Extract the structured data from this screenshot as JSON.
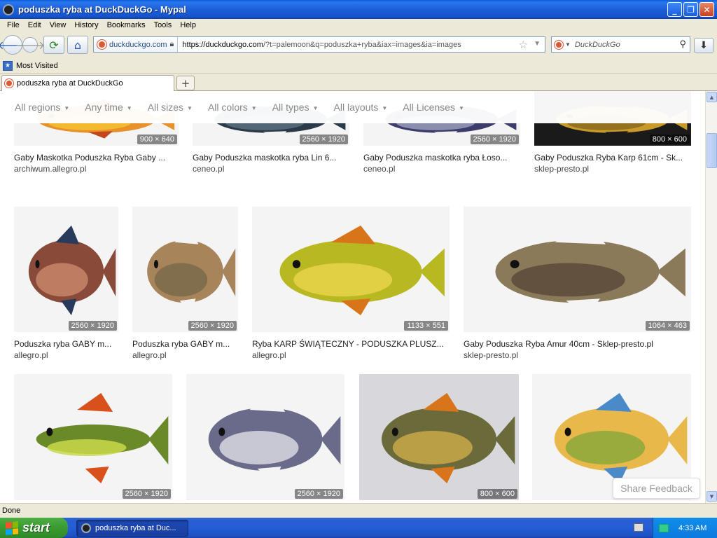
{
  "window": {
    "title": "poduszka ryba at DuckDuckGo - Mypal"
  },
  "menu": [
    "File",
    "Edit",
    "View",
    "History",
    "Bookmarks",
    "Tools",
    "Help"
  ],
  "nav": {
    "site_identity": "duckduckgo.com",
    "url_domain": "https://duckduckgo.com",
    "url_rest": "/?t=palemoon&q=poduszka+ryba&iax=images&ia=images",
    "search_placeholder": "DuckDuckGo"
  },
  "bookmarks": {
    "most_visited": "Most Visited"
  },
  "tab": {
    "title": "poduszka ryba at DuckDuckGo"
  },
  "filters": [
    "All regions",
    "Any time",
    "All sizes",
    "All colors",
    "All types",
    "All layouts",
    "All Licenses"
  ],
  "results": [
    {
      "caption": "Gaby Maskotka Poduszka Ryba Gaby ...",
      "source": "archiwum.allegro.pl",
      "dims": "900 × 640",
      "palette": [
        "#e8902a",
        "#f5c230",
        "#c4461d"
      ]
    },
    {
      "caption": "Gaby Poduszka maskotka ryba Lin 6...",
      "source": "ceneo.pl",
      "dims": "2560 × 1920",
      "palette": [
        "#2b3a48",
        "#5a6f7e",
        "#f4f4f4"
      ]
    },
    {
      "caption": "Gaby Poduszka maskotka ryba Łoso...",
      "source": "ceneo.pl",
      "dims": "2560 × 1920",
      "palette": [
        "#3b3c6a",
        "#9a9bb8",
        "#f4f4f4"
      ]
    },
    {
      "caption": "Gaby Poduszka Ryba Karp 61cm - Sk...",
      "source": "sklep-presto.pl",
      "dims": "800 × 600",
      "palette": [
        "#c79a2a",
        "#8a6a1c",
        "#1a1a1a"
      ]
    },
    {
      "caption": "Poduszka ryba GABY m...",
      "source": "allegro.pl",
      "dims": "2560 × 1920",
      "palette": [
        "#8a4a3a",
        "#c7856a",
        "#2a3a5a"
      ]
    },
    {
      "caption": "Poduszka ryba GABY m...",
      "source": "allegro.pl",
      "dims": "2560 × 1920",
      "palette": [
        "#a8845a",
        "#7a6a4a",
        "#f4f4f4"
      ]
    },
    {
      "caption": "Ryba KARP ŚWIĄTECZNY - PODUSZKA PLUSZ...",
      "source": "allegro.pl",
      "dims": "1133 × 551",
      "palette": [
        "#b8b822",
        "#e8d24a",
        "#d8741a"
      ]
    },
    {
      "caption": "Gaby Poduszka Ryba Amur 40cm - Sklep-presto.pl",
      "source": "sklep-presto.pl",
      "dims": "1064 × 463",
      "palette": [
        "#8a7a5a",
        "#5a4a3a",
        "#f4f4f4"
      ]
    },
    {
      "caption": "",
      "source": "",
      "dims": "2560 × 1920",
      "palette": [
        "#6a8a2a",
        "#c8d84a",
        "#d8501a"
      ]
    },
    {
      "caption": "",
      "source": "",
      "dims": "2560 × 1920",
      "palette": [
        "#6a6a8a",
        "#d8d8e0",
        "#f4f4f4"
      ]
    },
    {
      "caption": "",
      "source": "",
      "dims": "800 × 600",
      "palette": [
        "#6a6a3a",
        "#c8a84a",
        "#d8741a"
      ]
    },
    {
      "caption": "",
      "source": "",
      "dims": "",
      "palette": [
        "#e8b84a",
        "#8aa83a",
        "#4a8ac8"
      ]
    }
  ],
  "share_feedback": "Share Feedback",
  "status": "Done",
  "taskbar": {
    "start": "start",
    "task": "poduszka ryba at Duc...",
    "clock": "4:33 AM"
  }
}
